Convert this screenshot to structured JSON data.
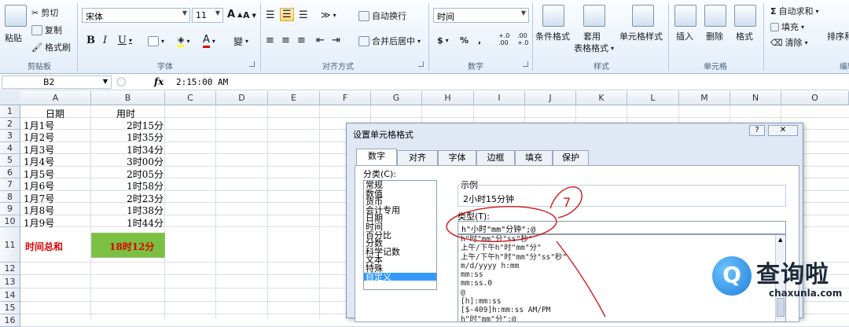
{
  "ribbon": {
    "clipboard": {
      "paste": "粘贴",
      "cut": "剪切",
      "copy": "复制",
      "format_painter": "格式刷",
      "group": "剪贴板"
    },
    "font": {
      "name": "宋体",
      "size": "11",
      "grow": "A",
      "shrink": "A",
      "bold": "B",
      "italic": "I",
      "underline": "U",
      "font_color_letter": "A",
      "phonetic": "變",
      "group": "字体"
    },
    "alignment": {
      "wrap_text": "自动换行",
      "merge_center": "合并后居中",
      "group": "对齐方式"
    },
    "number": {
      "format": "时间",
      "currency": "$",
      "percent": "%",
      "comma": ",",
      "inc_decimal": "+.0\n.00",
      "dec_decimal": ".00\n+.0",
      "group": "数字"
    },
    "styles": {
      "conditional": "条件格式",
      "table_format_1": "套用",
      "table_format_2": "表格格式",
      "cell_styles": "单元格样式",
      "group": "样式"
    },
    "cells": {
      "insert": "插入",
      "delete": "删除",
      "format": "格式",
      "group": "单元格"
    },
    "editing": {
      "autosum": "自动求和",
      "fill": "填充",
      "clear": "清除",
      "sort_filter": "排序和",
      "group": "编辑"
    }
  },
  "formula_bar": {
    "name_box": "B2",
    "fx": "fx",
    "value": "2:15:00 AM"
  },
  "sheet": {
    "columns": [
      "A",
      "B",
      "C",
      "D",
      "E",
      "F",
      "G",
      "H",
      "I",
      "J",
      "K",
      "L",
      "M",
      "N",
      "O"
    ],
    "rows": [
      "1",
      "2",
      "3",
      "4",
      "5",
      "6",
      "7",
      "8",
      "9",
      "10",
      "11",
      "12",
      "13",
      "14",
      "15",
      "16"
    ],
    "header_a": "日期",
    "header_b": "用时",
    "data": [
      {
        "date": "1月1号",
        "time": "2时15分"
      },
      {
        "date": "1月2号",
        "time": "1时35分"
      },
      {
        "date": "1月3号",
        "time": "1时34分"
      },
      {
        "date": "1月4号",
        "time": "3时00分"
      },
      {
        "date": "1月5号",
        "time": "2时05分"
      },
      {
        "date": "1月6号",
        "time": "1时58分"
      },
      {
        "date": "1月7号",
        "time": "2时23分"
      },
      {
        "date": "1月8号",
        "time": "1时38分"
      },
      {
        "date": "1月9号",
        "time": "1时44分"
      }
    ],
    "total_label": "时间总和",
    "total_value": "18时12分",
    "total_fill": "#7ac143",
    "total_text_color": "#e00000"
  },
  "dialog": {
    "title": "设置单元格格式",
    "help": "?",
    "close": "✕",
    "tabs": [
      "数字",
      "对齐",
      "字体",
      "边框",
      "填充",
      "保护"
    ],
    "category_label": "分类(C):",
    "categories": [
      "常规",
      "数值",
      "货币",
      "会计专用",
      "日期",
      "时间",
      "百分比",
      "分数",
      "科学记数",
      "文本",
      "特殊",
      "自定义"
    ],
    "selected_category": "自定义",
    "sample_label": "示例",
    "sample_value": "2小时15分钟",
    "type_label": "类型(T):",
    "type_value": "h\"小时\"mm\"分钟\";@",
    "format_list": [
      "h\"时\"mm\"分\"ss\"秒\"",
      "上午/下午h\"时\"mm\"分\"",
      "上午/下午h\"时\"mm\"分\"ss\"秒\"",
      "m/d/yyyy h:mm",
      "mm:ss",
      "mm:ss.0",
      "@",
      "[h]:mm:ss",
      "[$-409]h:mm:ss AM/PM",
      "h\"时\"mm\"分\";@"
    ],
    "annotation_number": "7"
  },
  "watermark": {
    "glyph": "Q",
    "name": "查询啦",
    "url": "chaxunla.com"
  }
}
